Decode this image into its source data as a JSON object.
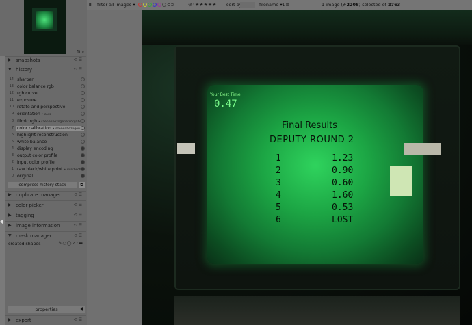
{
  "navigation": {
    "zoom_label": "fit"
  },
  "modules": {
    "snapshots": "snapshots",
    "history": "history",
    "duplicate_manager": "duplicate manager",
    "color_picker": "color picker",
    "tagging": "tagging",
    "image_information": "image information",
    "mask_manager": "mask manager",
    "export": "export"
  },
  "history": {
    "items": [
      {
        "num": "14",
        "label": "sharpen",
        "detail": ""
      },
      {
        "num": "13",
        "label": "color balance rgb",
        "detail": ""
      },
      {
        "num": "12",
        "label": "rgb curve",
        "detail": ""
      },
      {
        "num": "11",
        "label": "exposure",
        "detail": ""
      },
      {
        "num": "10",
        "label": "rotate and perspective",
        "detail": ""
      },
      {
        "num": "9",
        "label": "orientation",
        "detail": "• auto"
      },
      {
        "num": "8",
        "label": "filmic rgb",
        "detail": "• szenenbezogene Vorgabe"
      },
      {
        "num": "7",
        "label": "color calibration",
        "detail": "• szenenbezogen..."
      },
      {
        "num": "6",
        "label": "highlight reconstruction",
        "detail": ""
      },
      {
        "num": "5",
        "label": "white balance",
        "detail": ""
      },
      {
        "num": "4",
        "label": "display encoding",
        "detail": ""
      },
      {
        "num": "3",
        "label": "output color profile",
        "detail": ""
      },
      {
        "num": "2",
        "label": "input color profile",
        "detail": ""
      },
      {
        "num": "1",
        "label": "raw black/white point",
        "detail": "• durchschl..."
      },
      {
        "num": "0",
        "label": "original",
        "detail": ""
      }
    ],
    "compress_label": "compress history stack"
  },
  "mask_manager": {
    "created_shapes_label": "created shapes"
  },
  "properties_label": "properties",
  "top_bar": {
    "filter_label": "filter",
    "filter_value": "all images",
    "sort_label": "sort by",
    "sort_value": "filename",
    "count_pre": "1 image (#",
    "count_id": "2208",
    "count_mid": ") selected of ",
    "count_total": "2763"
  },
  "photo": {
    "best_label": "Your Best Time",
    "best_value": "0.47",
    "title": "Final Results",
    "subtitle": "DEPUTY ROUND 2",
    "scores": [
      {
        "rank": "1",
        "value": "1.23"
      },
      {
        "rank": "2",
        "value": "0.90"
      },
      {
        "rank": "3",
        "value": "0.60"
      },
      {
        "rank": "4",
        "value": "1.60"
      },
      {
        "rank": "5",
        "value": "0.53"
      },
      {
        "rank": "6",
        "value": "LOST"
      }
    ]
  },
  "colors": {
    "screen_green": "#2fd35d",
    "panel_gray": "#6a6a6a",
    "topbar_gray": "#757575",
    "red_label": "#c33",
    "yellow_label": "#cc3",
    "green_label": "#3a3",
    "blue_label": "#33c",
    "purple_label": "#939"
  }
}
